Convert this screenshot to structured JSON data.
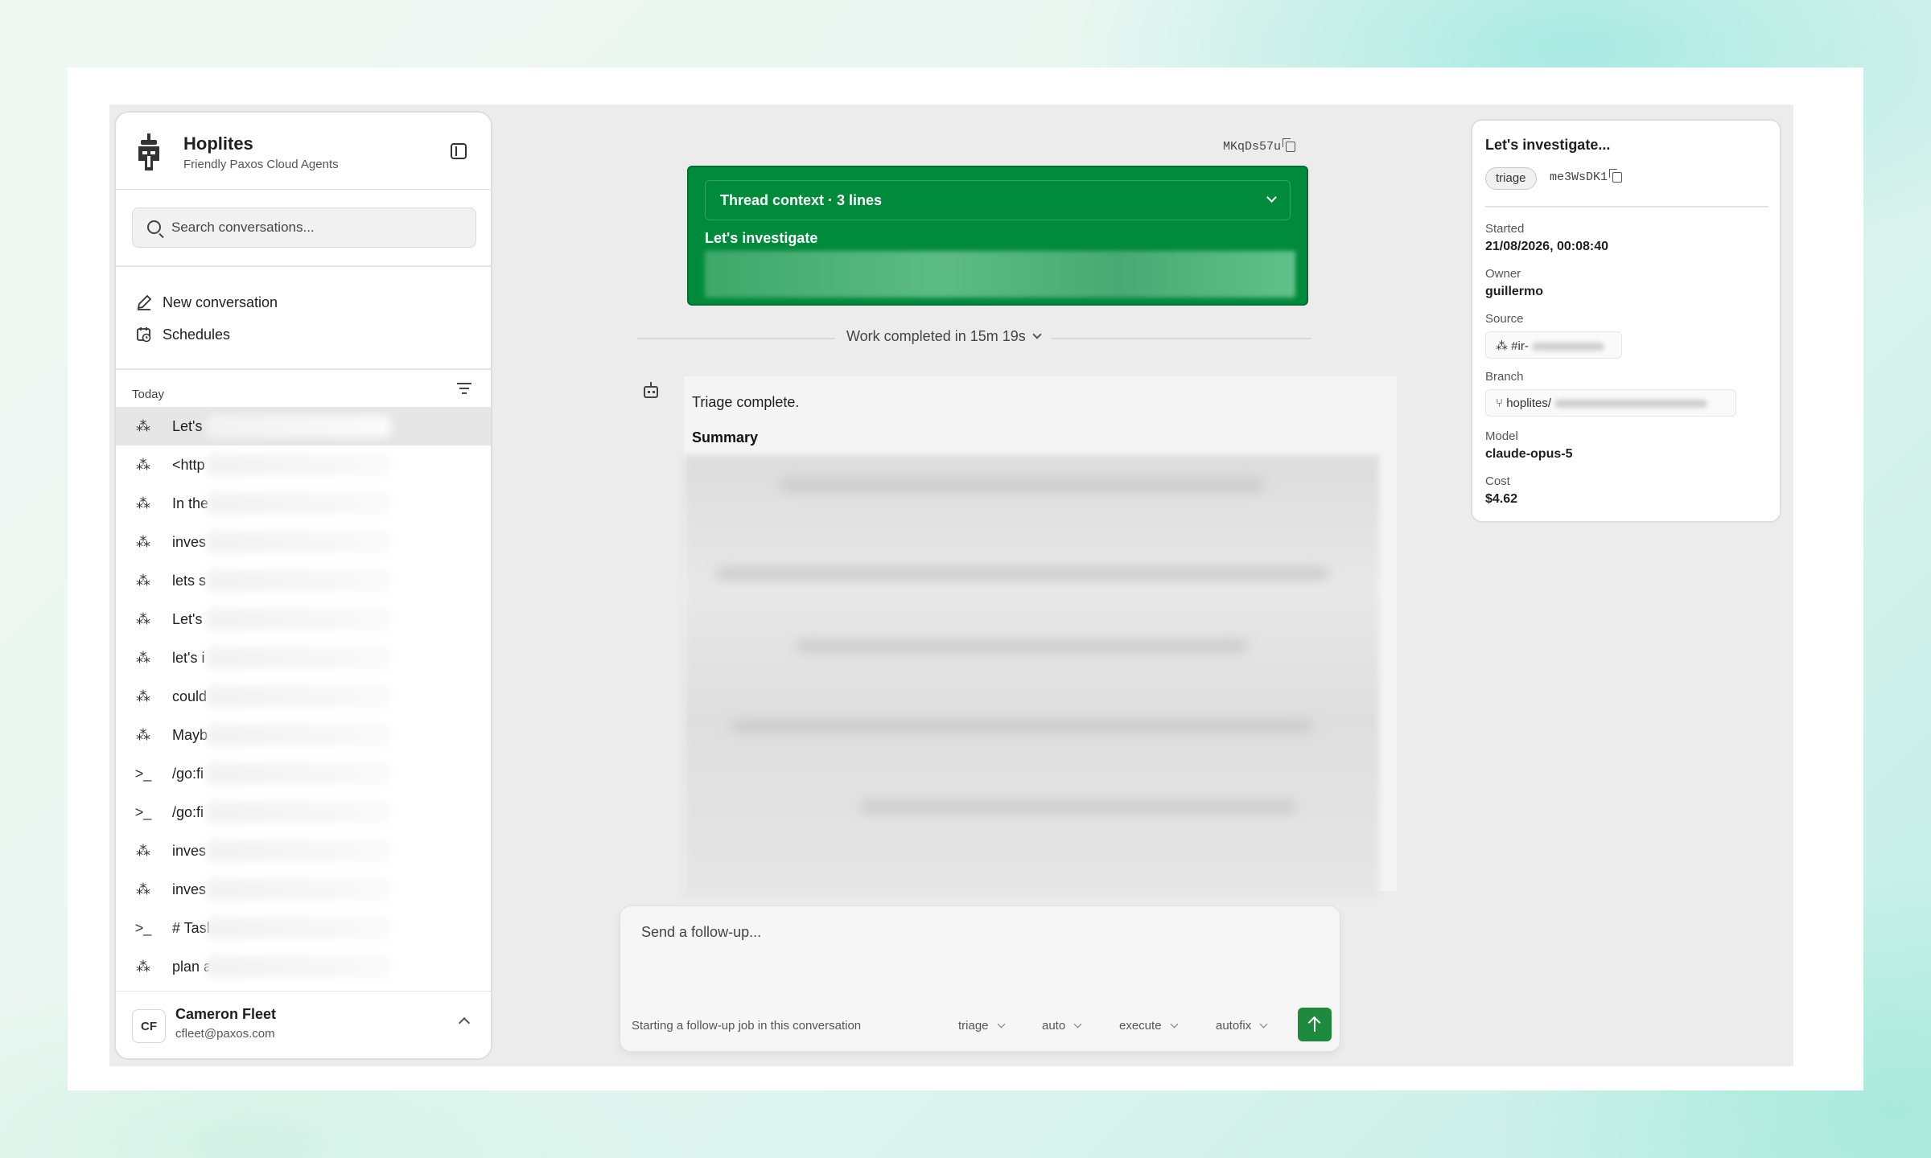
{
  "sidebar": {
    "brand_name": "Hoplites",
    "brand_subtitle": "Friendly Paxos Cloud Agents",
    "search_placeholder": "Search conversations...",
    "new_conversation": "New conversation",
    "schedules": "Schedules",
    "group_today": "Today",
    "conversations": [
      {
        "icon": "slack-icon",
        "text": "Let's"
      },
      {
        "icon": "slack-icon",
        "text": "<http"
      },
      {
        "icon": "slack-icon",
        "text": "In the"
      },
      {
        "icon": "slack-icon",
        "text": "inves"
      },
      {
        "icon": "slack-icon",
        "text": "lets s"
      },
      {
        "icon": "slack-icon",
        "text": "Let's"
      },
      {
        "icon": "slack-icon",
        "text": "let's i"
      },
      {
        "icon": "slack-icon",
        "text": "could"
      },
      {
        "icon": "slack-icon",
        "text": "Mayb"
      },
      {
        "icon": "terminal-icon",
        "text": "/go:fi"
      },
      {
        "icon": "terminal-icon",
        "text": "/go:fi"
      },
      {
        "icon": "slack-icon",
        "text": "inves"
      },
      {
        "icon": "slack-icon",
        "text": "inves"
      },
      {
        "icon": "terminal-icon",
        "text": "# Tasl"
      },
      {
        "icon": "slack-icon",
        "text": "plan a"
      }
    ],
    "user_initials": "CF",
    "user_name": "Cameron Fleet",
    "user_email": "cfleet@paxos.com"
  },
  "main": {
    "job_id": "MKqDs57u",
    "thread_context_label": "Thread context · 3 lines",
    "thread_title": "Let's investigate",
    "work_completed": "Work completed in 15m 19s",
    "message_text": "Triage complete.",
    "summary_heading": "Summary"
  },
  "composer": {
    "placeholder": "Send a follow-up...",
    "hint": "Starting a follow-up job in this conversation",
    "options": [
      "triage",
      "auto",
      "execute",
      "autofix"
    ]
  },
  "details": {
    "title": "Let's investigate...",
    "tag": "triage",
    "id": "me3WsDK1",
    "started_label": "Started",
    "started_value": "21/08/2026, 00:08:40",
    "owner_label": "Owner",
    "owner_value": "guillermo",
    "source_label": "Source",
    "source_value": "#ir-",
    "branch_label": "Branch",
    "branch_value": "hoplites/",
    "model_label": "Model",
    "model_value": "claude-opus-5",
    "cost_label": "Cost",
    "cost_value": "$4.62"
  },
  "colors": {
    "accent_green": "#008a3c",
    "send_button": "#1e8a3e"
  }
}
